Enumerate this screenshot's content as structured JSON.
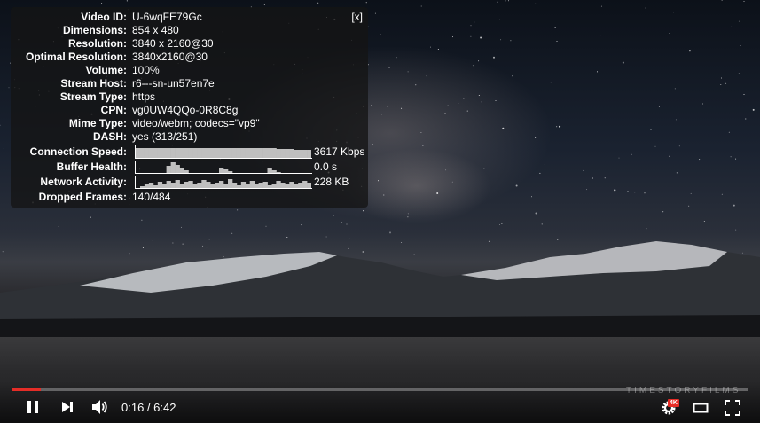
{
  "stats": {
    "close_label": "[x]",
    "rows": [
      {
        "label": "Video ID:",
        "value": "U-6wqFE79Gc"
      },
      {
        "label": "Dimensions:",
        "value": "854 x 480"
      },
      {
        "label": "Resolution:",
        "value": "3840 x 2160@30"
      },
      {
        "label": "Optimal Resolution:",
        "value": "3840x2160@30"
      },
      {
        "label": "Volume:",
        "value": "100%"
      },
      {
        "label": "Stream Host:",
        "value": "r6---sn-un57en7e"
      },
      {
        "label": "Stream Type:",
        "value": "https"
      },
      {
        "label": "CPN:",
        "value": "vg0UW4QQo-0R8C8g"
      },
      {
        "label": "Mime Type:",
        "value": "video/webm; codecs=\"vp9\""
      },
      {
        "label": "DASH:",
        "value": "yes (313/251)"
      }
    ],
    "graphs": [
      {
        "label": "Connection Speed:",
        "value": "3617 Kbps"
      },
      {
        "label": "Buffer Health:",
        "value": "0.0 s"
      },
      {
        "label": "Network Activity:",
        "value": "228 KB"
      }
    ],
    "dropped": {
      "label": "Dropped Frames:",
      "value": "140/484"
    }
  },
  "player": {
    "time": "0:16 / 6:42",
    "progress_fraction": 0.04,
    "quality_badge": "4K",
    "watermark": "TIMESTORYFILMS",
    "icons": {
      "play_pause": "pause-icon",
      "next": "next-icon",
      "volume": "volume-icon",
      "settings": "gear-icon",
      "theater": "theater-mode-icon",
      "fullscreen": "fullscreen-icon"
    }
  }
}
